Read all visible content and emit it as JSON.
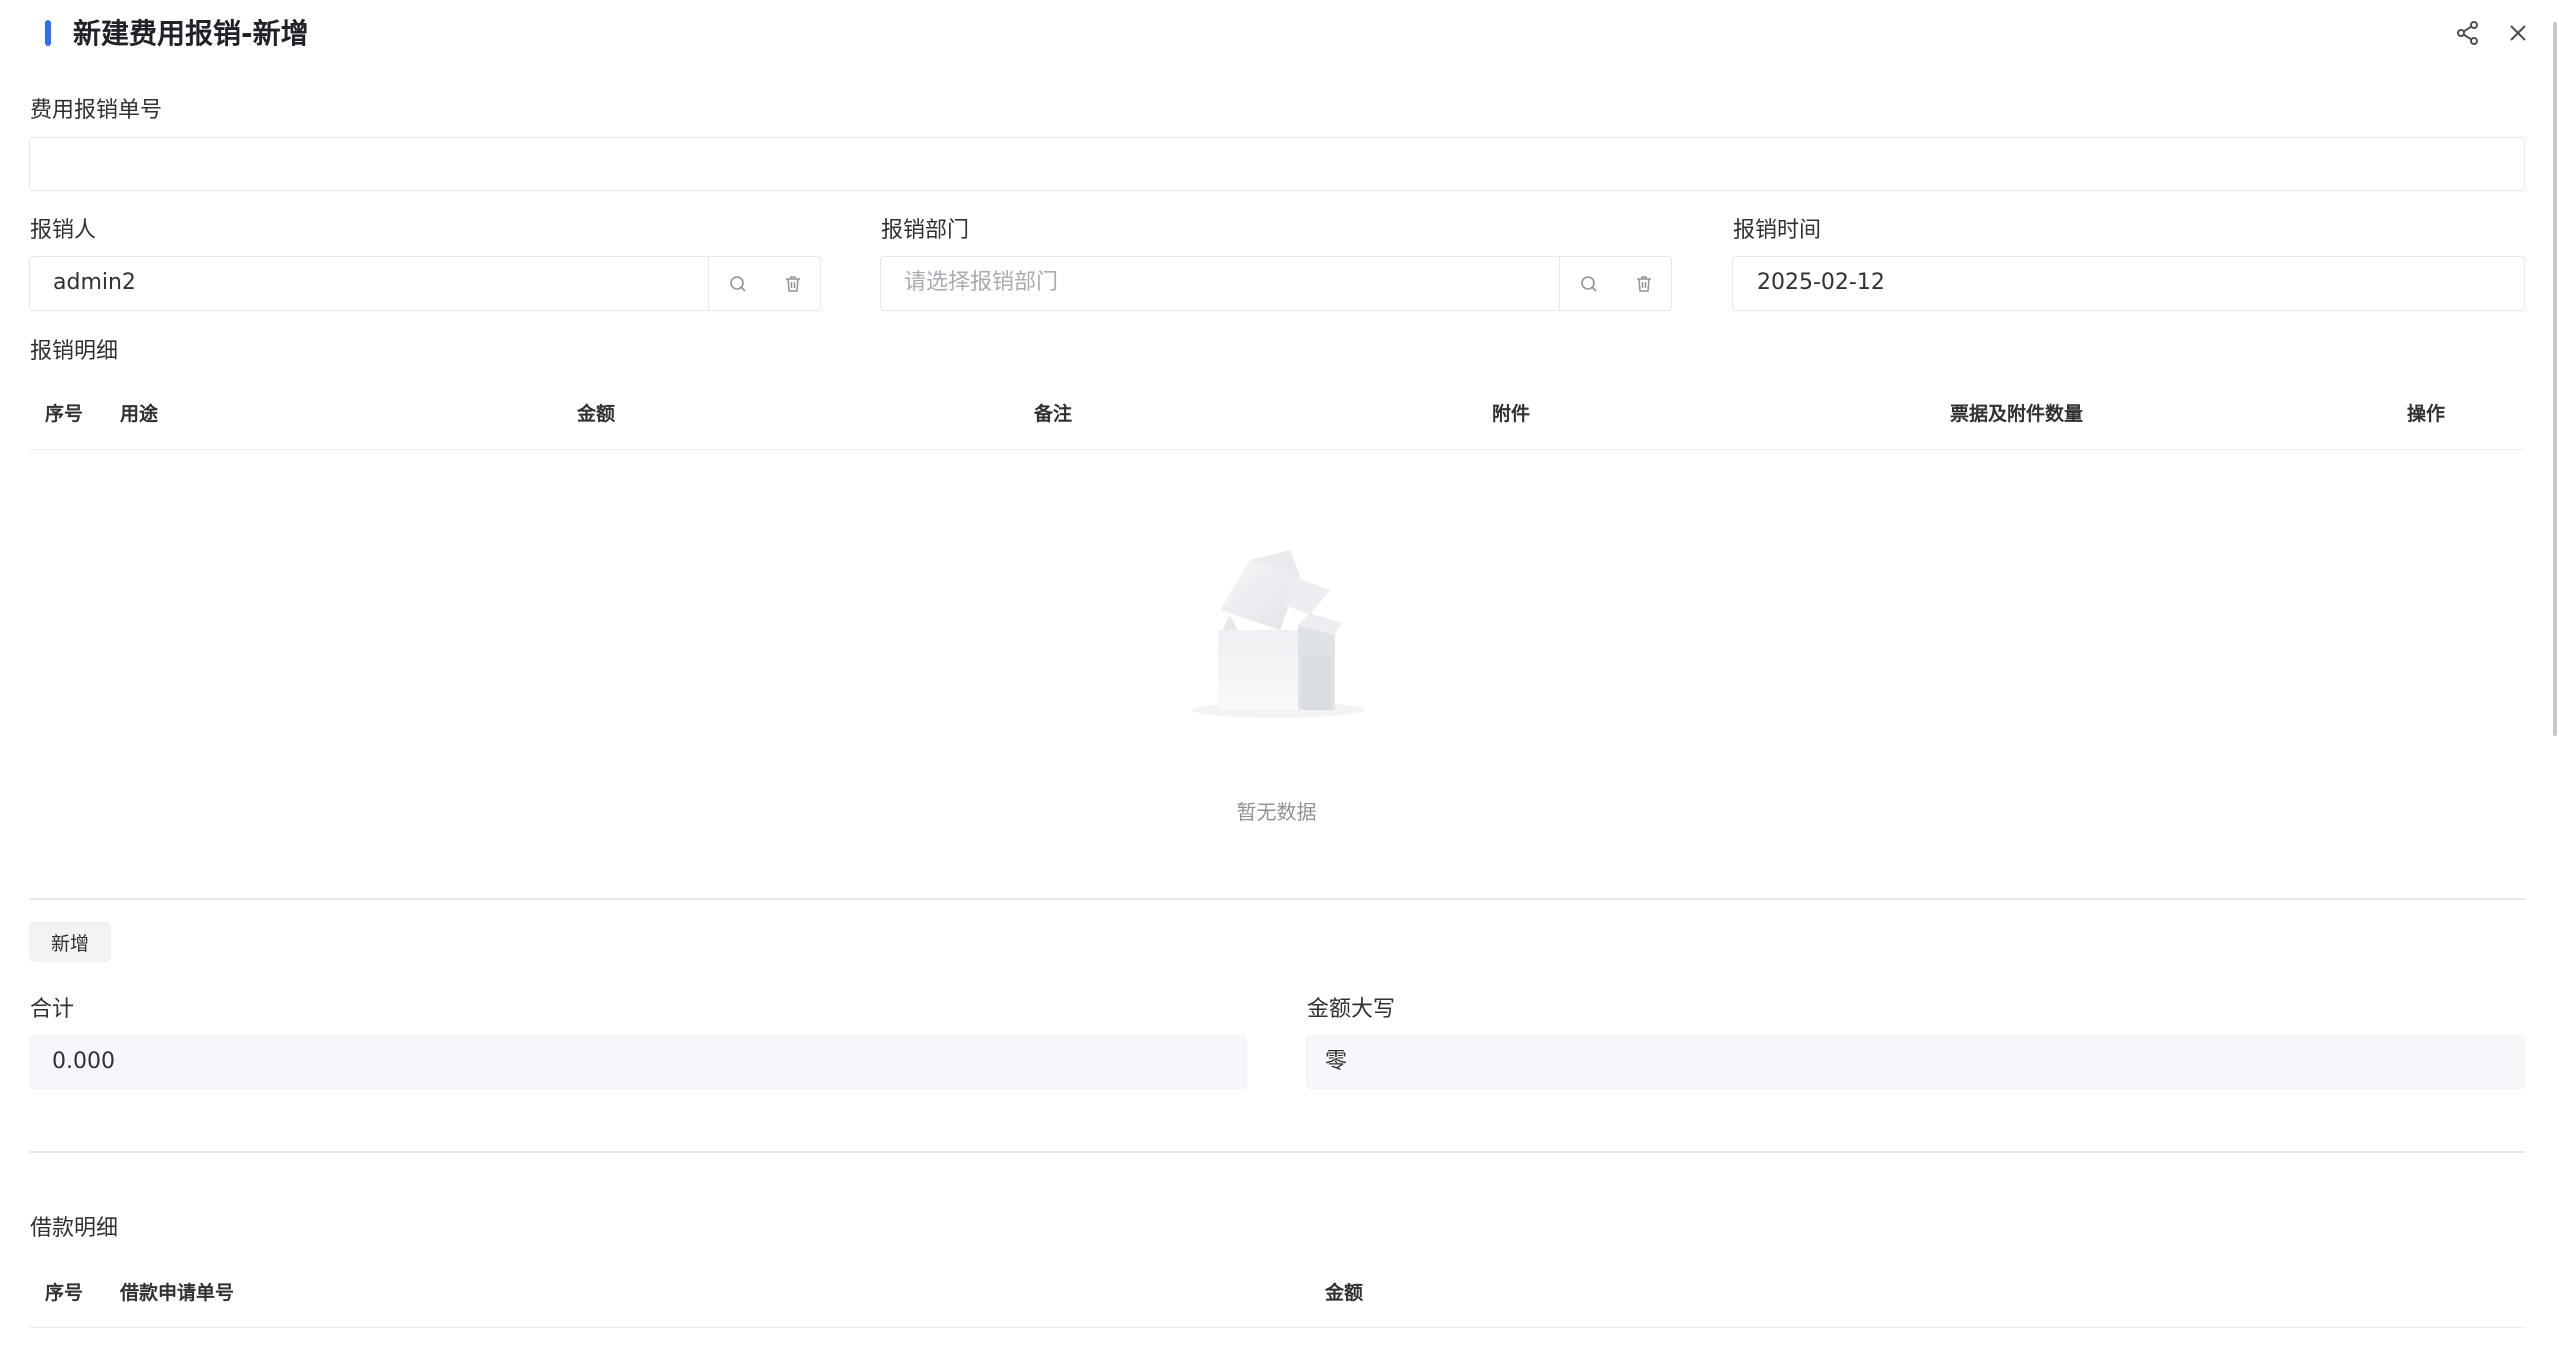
{
  "header": {
    "title": "新建费用报销-新增",
    "share_icon": "share-icon",
    "close_icon": "close-icon"
  },
  "form": {
    "order_no": {
      "label": "费用报销单号",
      "value": ""
    },
    "applicant": {
      "label": "报销人",
      "value": "admin2"
    },
    "department": {
      "label": "报销部门",
      "placeholder": "请选择报销部门"
    },
    "date": {
      "label": "报销时间",
      "value": "2025-02-12"
    }
  },
  "detail": {
    "section_label": "报销明细",
    "columns": [
      "序号",
      "用途",
      "金额",
      "备注",
      "附件",
      "票据及附件数量",
      "操作"
    ],
    "rows": [],
    "empty_text": "暂无数据",
    "add_label": "新增"
  },
  "totals": {
    "sum_label": "合计",
    "sum_value": "0.000",
    "upper_label": "金额大写",
    "upper_value": "零"
  },
  "loan": {
    "section_label": "借款明细",
    "columns": [
      "序号",
      "借款申请单号",
      "金额"
    ]
  },
  "colors": {
    "accent": "#2f6fed",
    "border": "#e4e7ed",
    "readonly_bg": "#f5f7fa"
  }
}
